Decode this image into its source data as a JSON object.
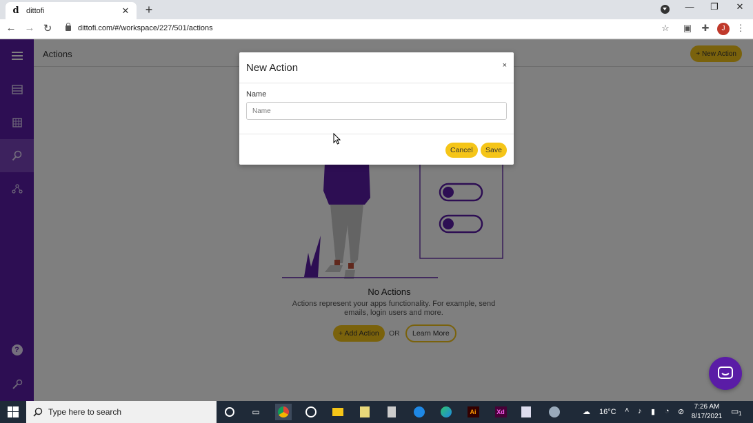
{
  "browser": {
    "tab_title": "dittofi",
    "tab_favicon": "d",
    "url": "dittofi.com/#/workspace/227/501/actions",
    "profile_initial": "J"
  },
  "sidebar": {
    "items": [
      {
        "icon": "menu-icon"
      },
      {
        "icon": "database-icon"
      },
      {
        "icon": "table-icon"
      },
      {
        "icon": "actions-icon",
        "active": true
      },
      {
        "icon": "workflow-icon"
      },
      {
        "icon": "help-icon"
      },
      {
        "icon": "settings-icon"
      }
    ]
  },
  "main": {
    "page_title": "Actions",
    "new_action_label": "+ New Action"
  },
  "empty_state": {
    "title": "No Actions",
    "description": "Actions represent your apps functionality. For example, send emails, login users and more.",
    "add_action_label": "+ Add Action",
    "or_label": "OR",
    "learn_more_label": "Learn More"
  },
  "modal": {
    "title": "New Action",
    "close_label": "×",
    "name_label": "Name",
    "name_placeholder": "Name",
    "name_value": "",
    "cancel_label": "Cancel",
    "save_label": "Save"
  },
  "taskbar": {
    "search_placeholder": "Type here to search",
    "temperature": "16°C",
    "time": "7:26 AM",
    "date": "8/17/2021",
    "notification_count": "1"
  },
  "colors": {
    "sidebar": "#5a1ca6",
    "accent": "#f5c518"
  }
}
